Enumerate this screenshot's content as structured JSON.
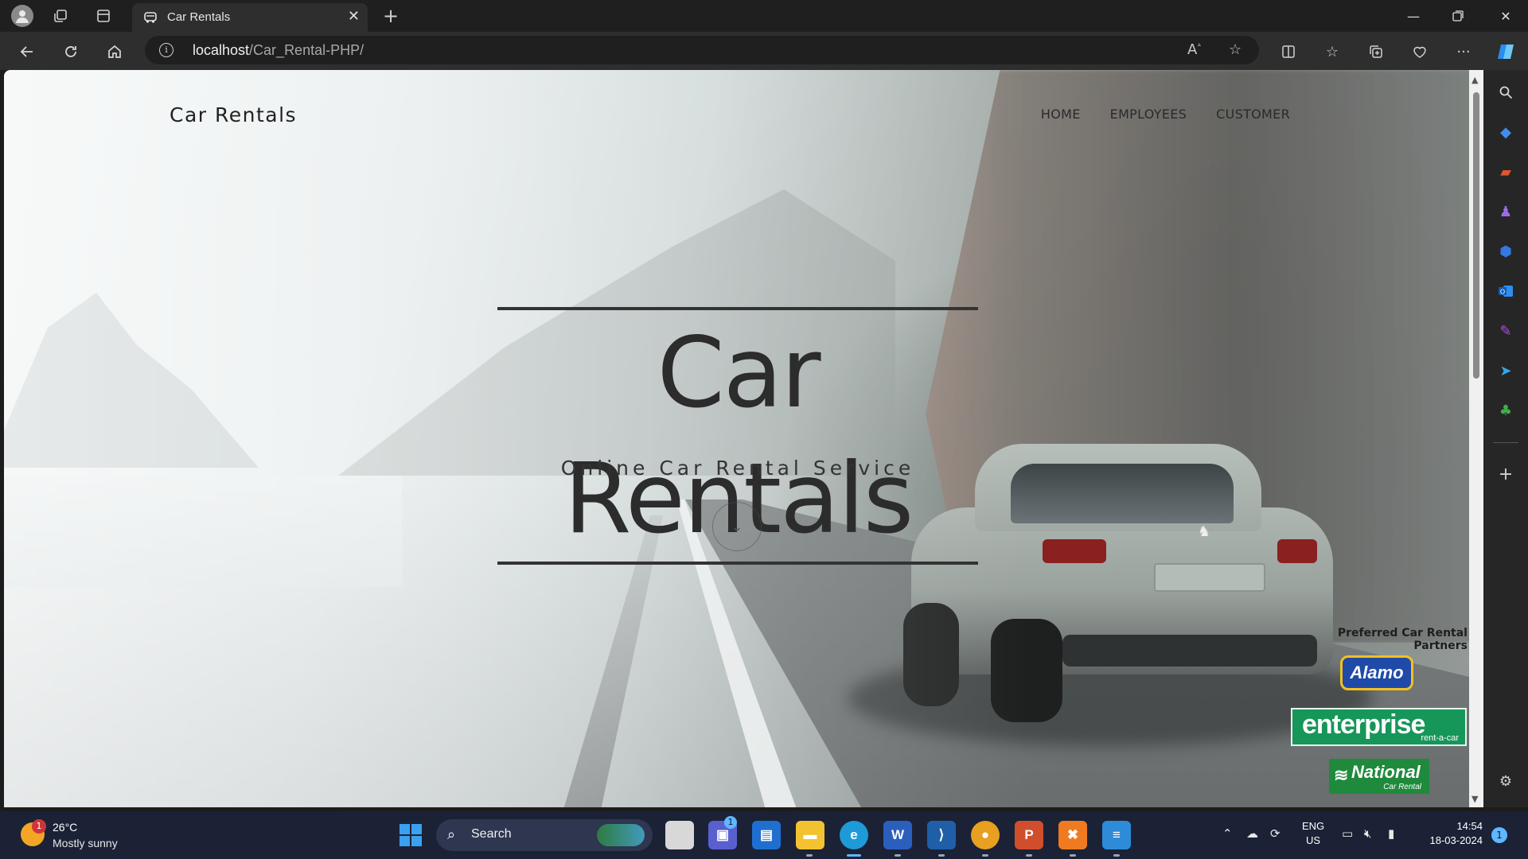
{
  "browser": {
    "tab_title": "Car Rentals",
    "url_host": "localhost",
    "url_path": "/Car_Rental-PHP/"
  },
  "site": {
    "brand": "Car Rentals",
    "nav": [
      "HOME",
      "EMPLOYEES",
      "CUSTOMER"
    ],
    "hero_title": "Car Rentals",
    "hero_subtitle": "Online Car Rental Service",
    "partners_title": "Preferred Car Rental Partners",
    "partners": {
      "alamo": "Alamo",
      "enterprise": "enterprise",
      "enterprise_tag": "rent-a-car",
      "national": "National",
      "national_tag": "Car Rental"
    }
  },
  "taskbar": {
    "weather_temp": "26°C",
    "weather_desc": "Mostly sunny",
    "weather_badge": "1",
    "search_label": "Search",
    "teams_badge": "1",
    "lang_line1": "ENG",
    "lang_line2": "US",
    "time": "14:54",
    "date": "18-03-2024",
    "notification_count": "1"
  },
  "colors": {
    "accent": "#5fb7ff",
    "taskbar_bg": "#1b2236",
    "enterprise_green": "#17965a",
    "alamo_blue": "#1f4aa8",
    "national_green": "#1f8a3c"
  }
}
